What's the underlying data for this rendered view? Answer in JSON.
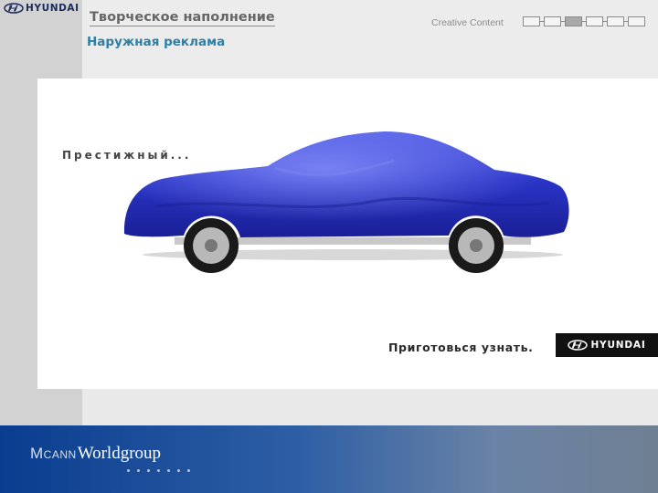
{
  "header": {
    "brand": "HYUNDAI",
    "title": "Творческое наполнение",
    "subtitle": "Наружная реклама",
    "section_label": "Creative Content",
    "nav_steps": 6,
    "nav_active_index": 2
  },
  "ad": {
    "headline": "Престижный...",
    "tagline": "Приготовься узнать.",
    "brand": "HYUNDAI",
    "car_cover_color": "#2a35c8"
  },
  "footer": {
    "logo_mc": "M",
    "logo_c": "C",
    "logo_ann": "ANN",
    "logo_worldgroup": "Worldgroup",
    "dot_count": 7
  },
  "colors": {
    "subtitle": "#2e7fa3",
    "footer_start": "#0a3d8f",
    "footer_end": "#6f7f92"
  }
}
